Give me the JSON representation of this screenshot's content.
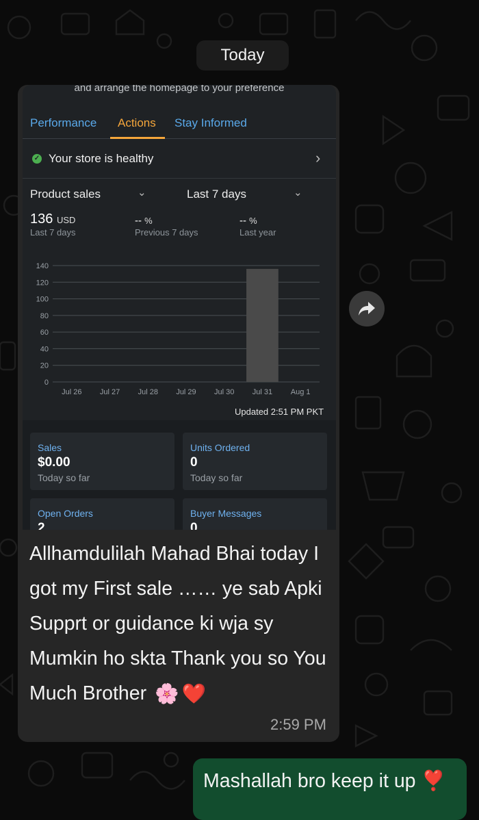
{
  "chat": {
    "date_label": "Today",
    "incoming": {
      "text": "Allhamdulilah Mahad Bhai today I got my First sale …… ye sab Apki Supprt or guidance ki wja sy Mumkin ho skta Thank you so You Much Brother",
      "emojis": [
        "🌸",
        "❤️"
      ],
      "time": "2:59 PM"
    },
    "outgoing": {
      "text": "Mashallah bro keep it up",
      "emoji": "❣️"
    }
  },
  "screenshot": {
    "header_cut_text": "and arrange the homepage to your preference",
    "tabs": [
      {
        "label": "Performance",
        "active": false
      },
      {
        "label": "Actions",
        "active": true
      },
      {
        "label": "Stay Informed",
        "active": false
      }
    ],
    "health_label": "Your store is healthy",
    "metric_dropdown": "Product sales",
    "period_dropdown": "Last 7 days",
    "metrics": [
      {
        "value": "136",
        "unit": "USD",
        "label": "Last 7 days"
      },
      {
        "value": "--",
        "unit": "%",
        "label": "Previous 7 days"
      },
      {
        "value": "--",
        "unit": "%",
        "label": "Last year"
      }
    ],
    "updated": "Updated 2:51 PM PKT",
    "cards": [
      {
        "title": "Sales",
        "value": "$0.00",
        "sub": "Today so far"
      },
      {
        "title": "Units Ordered",
        "value": "0",
        "sub": "Today so far"
      },
      {
        "title": "Open Orders",
        "value": "2",
        "sub": ""
      },
      {
        "title": "Buyer Messages",
        "value": "0",
        "sub": ""
      }
    ]
  },
  "chart_data": {
    "type": "bar",
    "categories": [
      "Jul 26",
      "Jul 27",
      "Jul 28",
      "Jul 29",
      "Jul 30",
      "Jul 31",
      "Aug 1"
    ],
    "values": [
      0,
      0,
      0,
      0,
      0,
      136,
      0
    ],
    "ylim": [
      0,
      140
    ],
    "yticks": [
      0,
      20,
      40,
      60,
      80,
      100,
      120,
      140
    ],
    "grid": true,
    "bar_color": "#4a4a4a"
  },
  "colors": {
    "tab_active": "#f5a63b",
    "link_blue": "#5aa9ea",
    "health_green": "#4caf50",
    "incoming_bubble": "#262626",
    "outgoing_bubble": "#124d2e"
  },
  "icons": [
    "check-circle-icon",
    "chevron-right-icon",
    "chevron-down-icon",
    "forward-icon"
  ]
}
